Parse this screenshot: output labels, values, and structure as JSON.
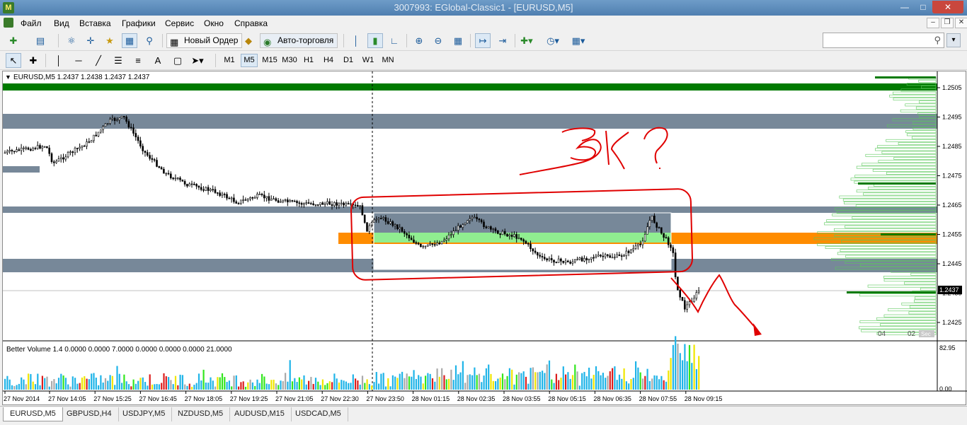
{
  "window": {
    "title": "3007993: EGlobal-Classic1 - [EURUSD,M5]"
  },
  "menu": [
    "Файл",
    "Вид",
    "Вставка",
    "Графики",
    "Сервис",
    "Окно",
    "Справка"
  ],
  "toolbar": {
    "new_order_label": "Новый Ордер",
    "autotrading_label": "Авто-торговля"
  },
  "search": {
    "placeholder": "",
    "value": ""
  },
  "timeframes": [
    "M1",
    "M5",
    "M15",
    "M30",
    "H1",
    "H4",
    "D1",
    "W1",
    "MN"
  ],
  "timeframe_active": "M5",
  "chart": {
    "header": "EURUSD,M5  1.2437 1.2438 1.2437 1.2437",
    "symbol": "EURUSD",
    "timeframe": "M5",
    "current_price_label": "1.2437",
    "price_axis": [
      "1.2505",
      "1.2495",
      "1.2485",
      "1.2475",
      "1.2465",
      "1.2455",
      "1.2445",
      "1.2435",
      "1.2425"
    ],
    "time_axis": [
      "27 Nov 2014",
      "27 Nov 14:05",
      "27 Nov 15:25",
      "27 Nov 16:45",
      "27 Nov 18:05",
      "27 Nov 19:25",
      "27 Nov 21:05",
      "27 Nov 22:30",
      "27 Nov 23:50",
      "28 Nov 01:15",
      "28 Nov 02:35",
      "28 Nov 03:55",
      "28 Nov 05:15",
      "28 Nov 06:35",
      "28 Nov 07:55",
      "28 Nov 09:15"
    ],
    "profile_labels": [
      "04",
      "02",
      "Sec"
    ],
    "annotation_text": "3K ?",
    "colors": {
      "bull_candle": "#ffffff",
      "bear_candle": "#000000",
      "zone_gray": "#778899",
      "zone_green_dark": "#007a00",
      "zone_green_light": "#90ee90",
      "zone_orange": "#ff8c00",
      "annotation_red": "#e00000",
      "volume_blue": "#1fb4e8",
      "volume_green": "#32e61e",
      "volume_red": "#dc1e1e",
      "volume_gray": "#aaaaaa",
      "volume_yellow": "#f0e600"
    }
  },
  "indicator": {
    "header": "Better Volume 1.4 0.0000 0.0000 7.0000 0.0000 0.0000 0.0000 21.0000",
    "scale_top": "82.95",
    "scale_bottom": "0.00"
  },
  "tabs": [
    "EURUSD,M5",
    "GBPUSD,H4",
    "USDJPY,M5",
    "NZDUSD,M5",
    "AUDUSD,M15",
    "USDCAD,M5"
  ],
  "active_tab": "EURUSD,M5"
}
